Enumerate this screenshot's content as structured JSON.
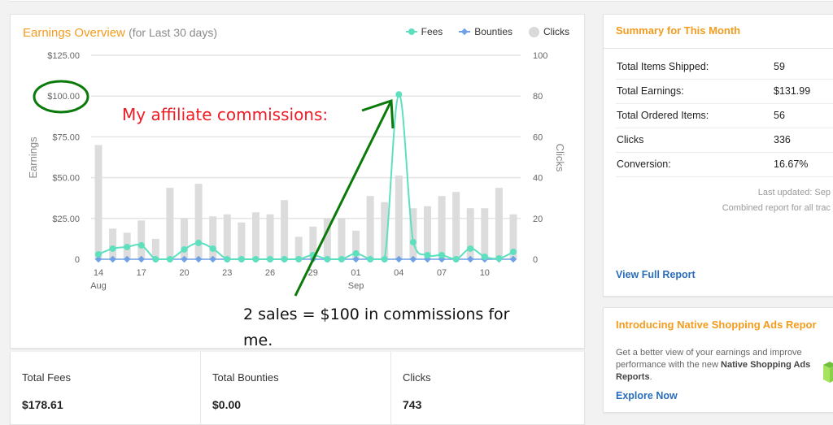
{
  "chart_card": {
    "title": "Earnings Overview",
    "subtitle": "(for Last 30 days)",
    "legend": [
      {
        "key": "fees",
        "label": "Fees",
        "icon": "circle-line-icon"
      },
      {
        "key": "bounties",
        "label": "Bounties",
        "icon": "diamond-line-icon"
      },
      {
        "key": "clicks",
        "label": "Clicks",
        "icon": "gray-circle-icon"
      }
    ]
  },
  "colors": {
    "accent": "#f39c1e",
    "fees": "#5ee0bf",
    "bounties": "#6ea1e6",
    "clicks": "#dcdcdc",
    "link": "#2a6ebb",
    "annotation_red": "#ee1c25",
    "annotation_green": "#0a7a0a"
  },
  "chart_data": {
    "type": "bar",
    "title": "Earnings Overview (for Last 30 days)",
    "xlabel": "",
    "ylabel": "Earnings",
    "y2label": "Clicks",
    "ylim": [
      0,
      125
    ],
    "y2lim": [
      0,
      100
    ],
    "y_ticks": [
      "0",
      "$25.00",
      "$50.00",
      "$75.00",
      "$100.00",
      "$125.00"
    ],
    "y_tick_values": [
      0,
      25,
      50,
      75,
      100,
      125
    ],
    "y2_ticks": [
      "0",
      "20",
      "40",
      "60",
      "80",
      "100"
    ],
    "y2_tick_values": [
      0,
      20,
      40,
      60,
      80,
      100
    ],
    "grid": true,
    "legend_position": "top-right",
    "categories": [
      "Aug 14",
      "Aug 15",
      "Aug 16",
      "Aug 17",
      "Aug 18",
      "Aug 19",
      "Aug 20",
      "Aug 21",
      "Aug 22",
      "Aug 23",
      "Aug 24",
      "Aug 25",
      "Aug 26",
      "Aug 27",
      "Aug 28",
      "Aug 29",
      "Aug 30",
      "Aug 31",
      "Sep 01",
      "Sep 02",
      "Sep 03",
      "Sep 04",
      "Sep 05",
      "Sep 06",
      "Sep 07",
      "Sep 08",
      "Sep 09",
      "Sep 10",
      "Sep 11",
      "Sep 12"
    ],
    "x_tick_labels": [
      {
        "index": 0,
        "label": "14",
        "sub": "Aug"
      },
      {
        "index": 3,
        "label": "17",
        "sub": ""
      },
      {
        "index": 6,
        "label": "20",
        "sub": ""
      },
      {
        "index": 9,
        "label": "23",
        "sub": ""
      },
      {
        "index": 12,
        "label": "26",
        "sub": ""
      },
      {
        "index": 15,
        "label": "29",
        "sub": ""
      },
      {
        "index": 18,
        "label": "01",
        "sub": "Sep"
      },
      {
        "index": 21,
        "label": "04",
        "sub": ""
      },
      {
        "index": 24,
        "label": "07",
        "sub": ""
      },
      {
        "index": 27,
        "label": "10",
        "sub": ""
      }
    ],
    "series": [
      {
        "name": "Clicks",
        "type": "bar",
        "axis": "right",
        "values": [
          56,
          15,
          13,
          19,
          10,
          35,
          20,
          37,
          21,
          22,
          18,
          23,
          22,
          29,
          11,
          16,
          20,
          20,
          14,
          31,
          28,
          41,
          25,
          26,
          31,
          33,
          25,
          25,
          35,
          22
        ]
      },
      {
        "name": "Fees",
        "type": "line",
        "axis": "left",
        "values": [
          3,
          6.5,
          7.5,
          8.5,
          0,
          0,
          6,
          10,
          6.5,
          0,
          0,
          0,
          0,
          0,
          0,
          2.5,
          0,
          0,
          3.5,
          0,
          0,
          101,
          10.5,
          2.5,
          2.5,
          0,
          6.5,
          1.5,
          0.5,
          4.5
        ]
      },
      {
        "name": "Bounties",
        "type": "line",
        "axis": "left",
        "values": [
          0,
          0,
          0,
          0,
          0,
          0,
          0,
          0,
          0,
          0,
          0,
          0,
          0,
          0,
          0,
          0,
          0,
          0,
          0,
          0,
          0,
          0,
          0,
          0,
          0,
          0,
          0,
          0,
          0,
          0
        ]
      }
    ],
    "annotations": [
      {
        "type": "ellipse",
        "target": "$100.00 tick"
      },
      {
        "type": "arrow",
        "from": "comment text",
        "to": "Sep 04 fees peak"
      }
    ]
  },
  "annotations": {
    "headline": "My affiliate commissions:",
    "comment": "2 sales = $100 in commissions for me."
  },
  "stats": [
    {
      "label": "Total Fees",
      "value": "$178.61"
    },
    {
      "label": "Total Bounties",
      "value": "$0.00"
    },
    {
      "label": "Clicks",
      "value": "743"
    }
  ],
  "summary": {
    "title": "Summary for This Month",
    "rows": [
      {
        "label": "Total Items Shipped:",
        "value": "59"
      },
      {
        "label": "Total Earnings:",
        "value": "$131.99"
      },
      {
        "label": "Total Ordered Items:",
        "value": "56"
      },
      {
        "label": "Clicks",
        "value": "336"
      },
      {
        "label": "Conversion:",
        "value": "16.67%"
      }
    ],
    "last_updated": "Last updated: Sep",
    "combined_note": "Combined report for all trac",
    "view_report_link": "View Full Report"
  },
  "promo": {
    "title": "Introducing Native Shopping Ads Repor",
    "text_before": "Get a better view of your earnings and improve performance with the new ",
    "text_bold": "Native Shopping Ads Reports",
    "text_after": ".",
    "link": "Explore Now",
    "icon": "green-box-icon"
  }
}
